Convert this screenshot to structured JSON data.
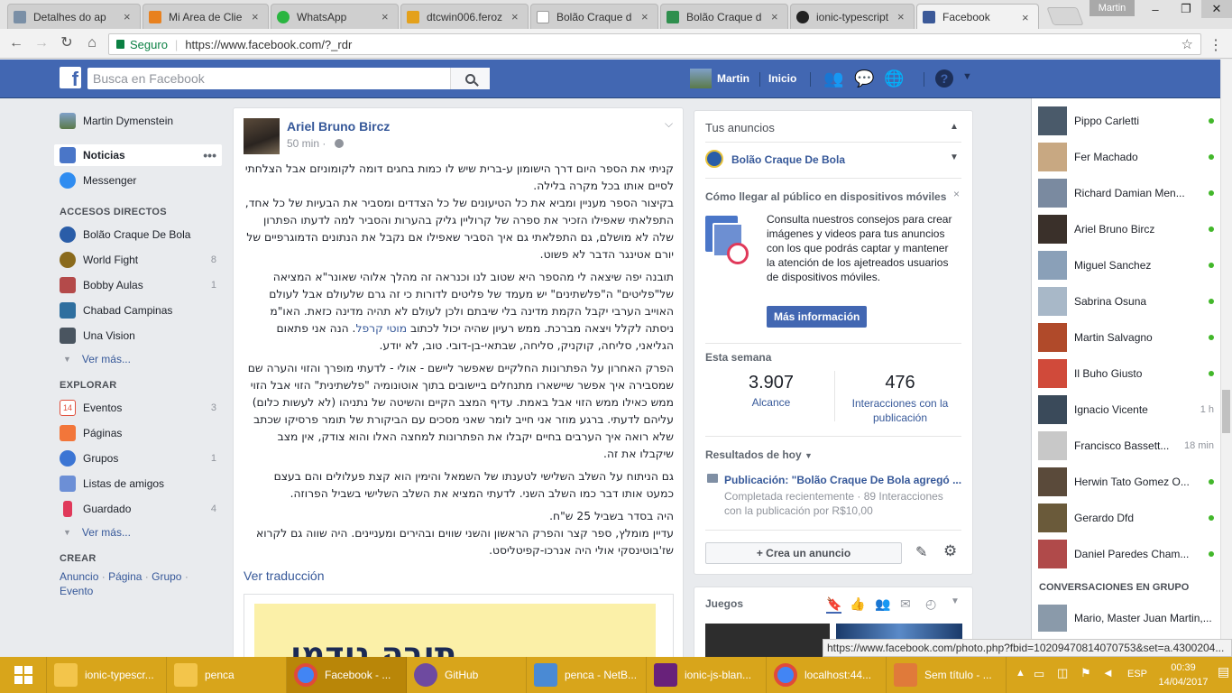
{
  "browser": {
    "tabs": [
      {
        "title": "Detalhes do ap",
        "color": "#7a8fa6"
      },
      {
        "title": "Mi Area de Clie",
        "color": "#e8811f"
      },
      {
        "title": "WhatsApp",
        "color": "#2ab540"
      },
      {
        "title": "dtcwin006.feroz",
        "color": "#e4a11b"
      },
      {
        "title": "Bolão Craque d",
        "color": "#bbbbbb"
      },
      {
        "title": "Bolão Craque d",
        "color": "#2f8f4e"
      },
      {
        "title": "ionic-typescript",
        "color": "#222222"
      },
      {
        "title": "Facebook",
        "color": "#3b5998"
      }
    ],
    "profile": "Martin",
    "secure_label": "Seguro",
    "url": "https://www.facebook.com/?_rdr"
  },
  "fb": {
    "logo": "f",
    "search_placeholder": "Busca en Facebook",
    "user": "Martin",
    "home": "Inicio"
  },
  "left": {
    "profile_name": "Martin Dymenstein",
    "news": "Noticias",
    "messenger": "Messenger",
    "shortcuts_title": "ACCESOS DIRECTOS",
    "shortcuts": [
      {
        "label": "Bolão Craque De Bola",
        "count": "",
        "color": "#2a5da8"
      },
      {
        "label": "World Fight",
        "count": "8",
        "color": "#8a6a1c"
      },
      {
        "label": "Bobby Aulas",
        "count": "1",
        "color": "#b44a4a"
      },
      {
        "label": "Chabad Campinas",
        "count": "",
        "color": "#2f6f9f"
      },
      {
        "label": "Una Vision",
        "count": "",
        "color": "#4a5560"
      }
    ],
    "see_more": "Ver más...",
    "explore_title": "EXPLORAR",
    "explore": [
      {
        "label": "Eventos",
        "count": "3",
        "color": "#e04f3c"
      },
      {
        "label": "Páginas",
        "count": "",
        "color": "#f2763a"
      },
      {
        "label": "Grupos",
        "count": "1",
        "color": "#3b75d4"
      },
      {
        "label": "Listas de amigos",
        "count": "",
        "color": "#6c8fd6"
      },
      {
        "label": "Guardado",
        "count": "4",
        "color": "#e0395a"
      }
    ],
    "create_title": "CREAR",
    "create_1": "Anuncio",
    "create_2": "Página",
    "create_3": "Grupo",
    "create_4": "Evento",
    "dot": "·"
  },
  "post": {
    "author": "Ariel Bruno Bircz",
    "time": "50 min",
    "p1": "קניתי את הספר היום דרך הישומון ע-ברית שיש לו כמות בחגים דומה לקומוניזם אבל הצלחתי לסיים אותו בכל מקרה בלילה.",
    "p2": "בקיצור הספר מעניין ומביא את כל הטיעונים של כל הצדדים ומסביר את הבעיות של כל אחד, התפלאתי שאפילו הזכיר את ספרה של קרוליין גליק בהערות והסביר למה לדעתו הפתרון שלה לא מושלם, גם התפלאתי גם איך הסביר שאפילו אם נקבל את הנתונים הדמוגרפיים של יורם אטינגר הדבר לא פשוט.",
    "p3": "תובנה יפה שיצאה לי מהספר היא שטוב לנו וכנראה זה מהלך אלוהי שאונר\"א המציאה של\"פליטים\" ה\"פלשתינים\" יש מעמד של פליטים לדורות כי זה גרם שלעולם אבל לעולם האוייב הערבי יקבל הקמת מדינה בלי שיבתם ולכן לעולם לא תהיה מדינה כזאת. האו\"מ ניסתה לקלל ויצאה מברכת. ממש רעיון שהיה יכול לכתוב",
    "p3_link": "מוטי קרפל",
    "p3_end": ". הנה אני פתאום הגליאני, סליחה, קוקניק, סליחה, שבתאי-בן-דובי. טוב, לא יודע.",
    "p4": "הפרק האחרון על הפתרונות החלקיים שאפשר ליישם - אולי - לדעתי מופרך והזוי והערה שם שמסבירה איך אפשר שיישארו מתנחלים ביישובים בתוך אוטונומיה \"פלשתינית\" הזוי אבל הזוי ממש כאילו ממש הזוי אבל באמת. עדיף המצב הקיים והשיטה של נתניהו (לא לעשות כלום) עליהם לדעתי. ברגע מוזר אני חייב לומר שאני מסכים עם הביקורת של תומר פרסיקו שכתב שלא רואה איך הערבים בחיים יקבלו את הפתרונות למחצה האלו והוא צודק, אין מצב שיקבלו את זה.",
    "p5": "גם הניתוח על השלב השלישי לטענתו של השמאל והימין הוא קצת פעלולים והם בעצם כמעט אותו דבר כמו השלב השני. לדעתי המציא את השלב השלישי בשביל הפרוזה.",
    "p6": "היה בסדר בשביל 25 ש\"ח.",
    "p7": "עדיין מומלץ, ספר קצר והפרק הראשון והשני שווים ובהירים ומעניינים. היה שווה גם לקרוא שז'בוטינסקי אולי היה אנרכו-קפיטליסט.",
    "see_translation": "Ver traducción",
    "shared_title": "תובה נודמו"
  },
  "ads": {
    "title": "Tus anuncios",
    "page": "Bolão Craque De Bola",
    "tip_title": "Cómo llegar al público en dispositivos móviles",
    "tip_body": "Consulta nuestros consejos para crear imágenes y videos para tus anuncios con los que podrás captar y mantener la atención de los ajetreados usuarios de dispositivos móviles.",
    "more_info": "Más información",
    "week": "Esta semana",
    "reach_value": "3.907",
    "reach_label": "Alcance",
    "inter_value": "476",
    "inter_label": "Interacciones con la publicación",
    "results": "Resultados de hoy",
    "pub_title": "Publicación: \"Bolão Craque De Bola agregó ...",
    "pub_status": "Completada recientemente · 89 Interacciones con la publicación por R$10,00",
    "create_ad": "+ Crea un anuncio",
    "games": "Juegos"
  },
  "chat": {
    "friends": [
      {
        "name": "Pippo Carletti",
        "time": "",
        "online": true,
        "color": "#4a5a6a"
      },
      {
        "name": "Fer Machado",
        "time": "",
        "online": true,
        "color": "#c8a882"
      },
      {
        "name": "Richard Damian Men...",
        "time": "",
        "online": true,
        "color": "#7a8aa0"
      },
      {
        "name": "Ariel Bruno Bircz",
        "time": "",
        "online": true,
        "color": "#3a302a"
      },
      {
        "name": "Miguel Sanchez",
        "time": "",
        "online": true,
        "color": "#8aa0b8"
      },
      {
        "name": "Sabrina Osuna",
        "time": "",
        "online": true,
        "color": "#a8b8c8"
      },
      {
        "name": "Martin Salvagno",
        "time": "",
        "online": true,
        "color": "#b04a2a"
      },
      {
        "name": "Il Buho Giusto",
        "time": "",
        "online": true,
        "color": "#d04a3a"
      },
      {
        "name": "Ignacio Vicente",
        "time": "1 h",
        "online": false,
        "color": "#3a4a5a"
      },
      {
        "name": "Francisco Bassett...",
        "time": "18 min",
        "online": false,
        "color": "#c8c8c8"
      },
      {
        "name": "Herwin Tato Gomez O...",
        "time": "",
        "online": true,
        "color": "#5a4a3a"
      },
      {
        "name": "Gerardo Dfd",
        "time": "",
        "online": true,
        "color": "#6a5a3a"
      },
      {
        "name": "Daniel Paredes Cham...",
        "time": "",
        "online": true,
        "color": "#b04a4a"
      }
    ],
    "group_title": "CONVERSACIONES EN GRUPO",
    "group_name": "Mario, Master Juan Martin,..."
  },
  "status_url": "https://www.facebook.com/photo.php?fbid=10209470814070753&set=a.4300204...",
  "taskbar": {
    "items": [
      {
        "label": "ionic-typescr...",
        "color": "#f3c54b"
      },
      {
        "label": "penca",
        "color": "#f3c54b"
      },
      {
        "label": "Facebook - ...",
        "color": "#4285f4"
      },
      {
        "label": "GitHub",
        "color": "#6e4aa0"
      },
      {
        "label": "penca - NetB...",
        "color": "#4a8ad4"
      },
      {
        "label": "ionic-js-blan...",
        "color": "#68217a"
      },
      {
        "label": "localhost:44...",
        "color": "#4285f4"
      },
      {
        "label": "Sem título - ...",
        "color": "#e07a3a"
      }
    ],
    "lang": "ESP",
    "time": "00:39",
    "date": "14/04/2017"
  }
}
